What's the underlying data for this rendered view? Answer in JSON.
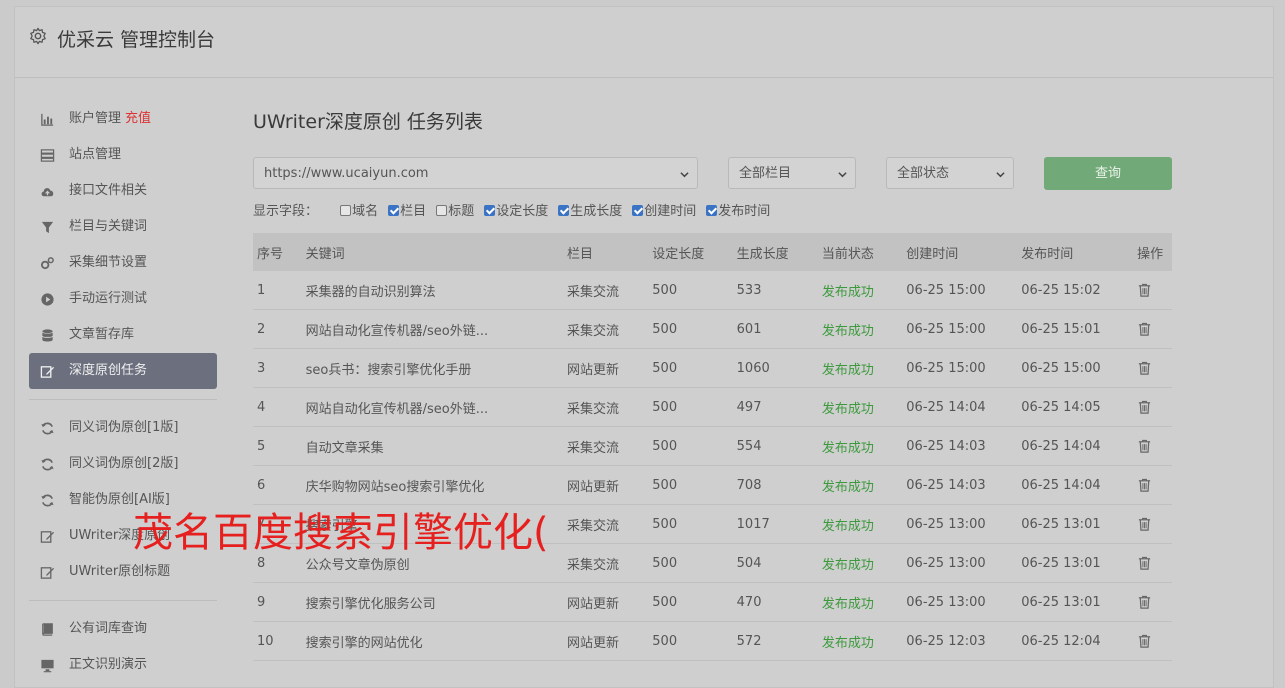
{
  "header": {
    "title": "优采云 管理控制台",
    "icon": "gear-icon"
  },
  "sidebar": {
    "groups": [
      [
        {
          "label": "账户管理",
          "extra": "充值",
          "icon": "bar-chart-icon"
        },
        {
          "label": "站点管理",
          "icon": "server-icon"
        },
        {
          "label": "接口文件相关",
          "icon": "cloud-upload-icon"
        },
        {
          "label": "栏目与关键词",
          "icon": "filter-icon"
        },
        {
          "label": "采集细节设置",
          "icon": "gears-icon"
        },
        {
          "label": "手动运行测试",
          "icon": "play-icon"
        },
        {
          "label": "文章暂存库",
          "icon": "database-icon"
        },
        {
          "label": "深度原创任务",
          "icon": "edit-icon",
          "active": true
        }
      ],
      [
        {
          "label": "同义词伪原创[1版]",
          "icon": "refresh-icon"
        },
        {
          "label": "同义词伪原创[2版]",
          "icon": "refresh-icon"
        },
        {
          "label": "智能伪原创[AI版]",
          "icon": "refresh-icon"
        },
        {
          "label": "UWriter深度原创",
          "icon": "edit-icon"
        },
        {
          "label": "UWriter原创标题",
          "icon": "edit-icon"
        }
      ],
      [
        {
          "label": "公有词库查询",
          "icon": "book-icon"
        },
        {
          "label": "正文识别演示",
          "icon": "monitor-icon"
        }
      ]
    ]
  },
  "main": {
    "title": "UWriter深度原创 任务列表",
    "site_select": "https://www.ucaiyun.com",
    "column_select": "全部栏目",
    "status_select": "全部状态",
    "query_label": "查询",
    "fields_label": "显示字段：",
    "fields": [
      {
        "label": "域名",
        "checked": false
      },
      {
        "label": "栏目",
        "checked": true
      },
      {
        "label": "标题",
        "checked": false
      },
      {
        "label": "设定长度",
        "checked": true
      },
      {
        "label": "生成长度",
        "checked": true
      },
      {
        "label": "创建时间",
        "checked": true
      },
      {
        "label": "发布时间",
        "checked": true
      }
    ],
    "table": {
      "headers": [
        "序号",
        "关键词",
        "栏目",
        "设定长度",
        "生成长度",
        "当前状态",
        "创建时间",
        "发布时间",
        "操作"
      ],
      "rows": [
        [
          "1",
          "采集器的自动识别算法",
          "采集交流",
          "500",
          "533",
          "发布成功",
          "06-25 15:00",
          "06-25 15:02"
        ],
        [
          "2",
          "网站自动化宣传机器/seo外链...",
          "采集交流",
          "500",
          "601",
          "发布成功",
          "06-25 15:00",
          "06-25 15:01"
        ],
        [
          "3",
          "seo兵书：搜索引擎优化手册",
          "网站更新",
          "500",
          "1060",
          "发布成功",
          "06-25 15:00",
          "06-25 15:00"
        ],
        [
          "4",
          "网站自动化宣传机器/seo外链...",
          "采集交流",
          "500",
          "497",
          "发布成功",
          "06-25 14:04",
          "06-25 14:05"
        ],
        [
          "5",
          "自动文章采集",
          "采集交流",
          "500",
          "554",
          "发布成功",
          "06-25 14:03",
          "06-25 14:04"
        ],
        [
          "6",
          "庆华购物网站seo搜索引擎优化",
          "网站更新",
          "500",
          "708",
          "发布成功",
          "06-25 14:03",
          "06-25 14:04"
        ],
        [
          "7",
          "搜索引擎",
          "采集交流",
          "500",
          "1017",
          "发布成功",
          "06-25 13:00",
          "06-25 13:01"
        ],
        [
          "8",
          "公众号文章伪原创",
          "采集交流",
          "500",
          "504",
          "发布成功",
          "06-25 13:00",
          "06-25 13:01"
        ],
        [
          "9",
          "搜索引擎优化服务公司",
          "网站更新",
          "500",
          "470",
          "发布成功",
          "06-25 13:00",
          "06-25 13:01"
        ],
        [
          "10",
          "搜索引擎的网站优化",
          "网站更新",
          "500",
          "572",
          "发布成功",
          "06-25 12:03",
          "06-25 12:04"
        ]
      ]
    }
  },
  "overlay": {
    "text": "茂名百度搜索引擎优化("
  },
  "colors": {
    "active_bg": "#6c6f7e",
    "query_btn": "#72a978",
    "status_ok": "#3c9a3c",
    "recharge": "#dd3333",
    "overlay": "#e5201f"
  }
}
